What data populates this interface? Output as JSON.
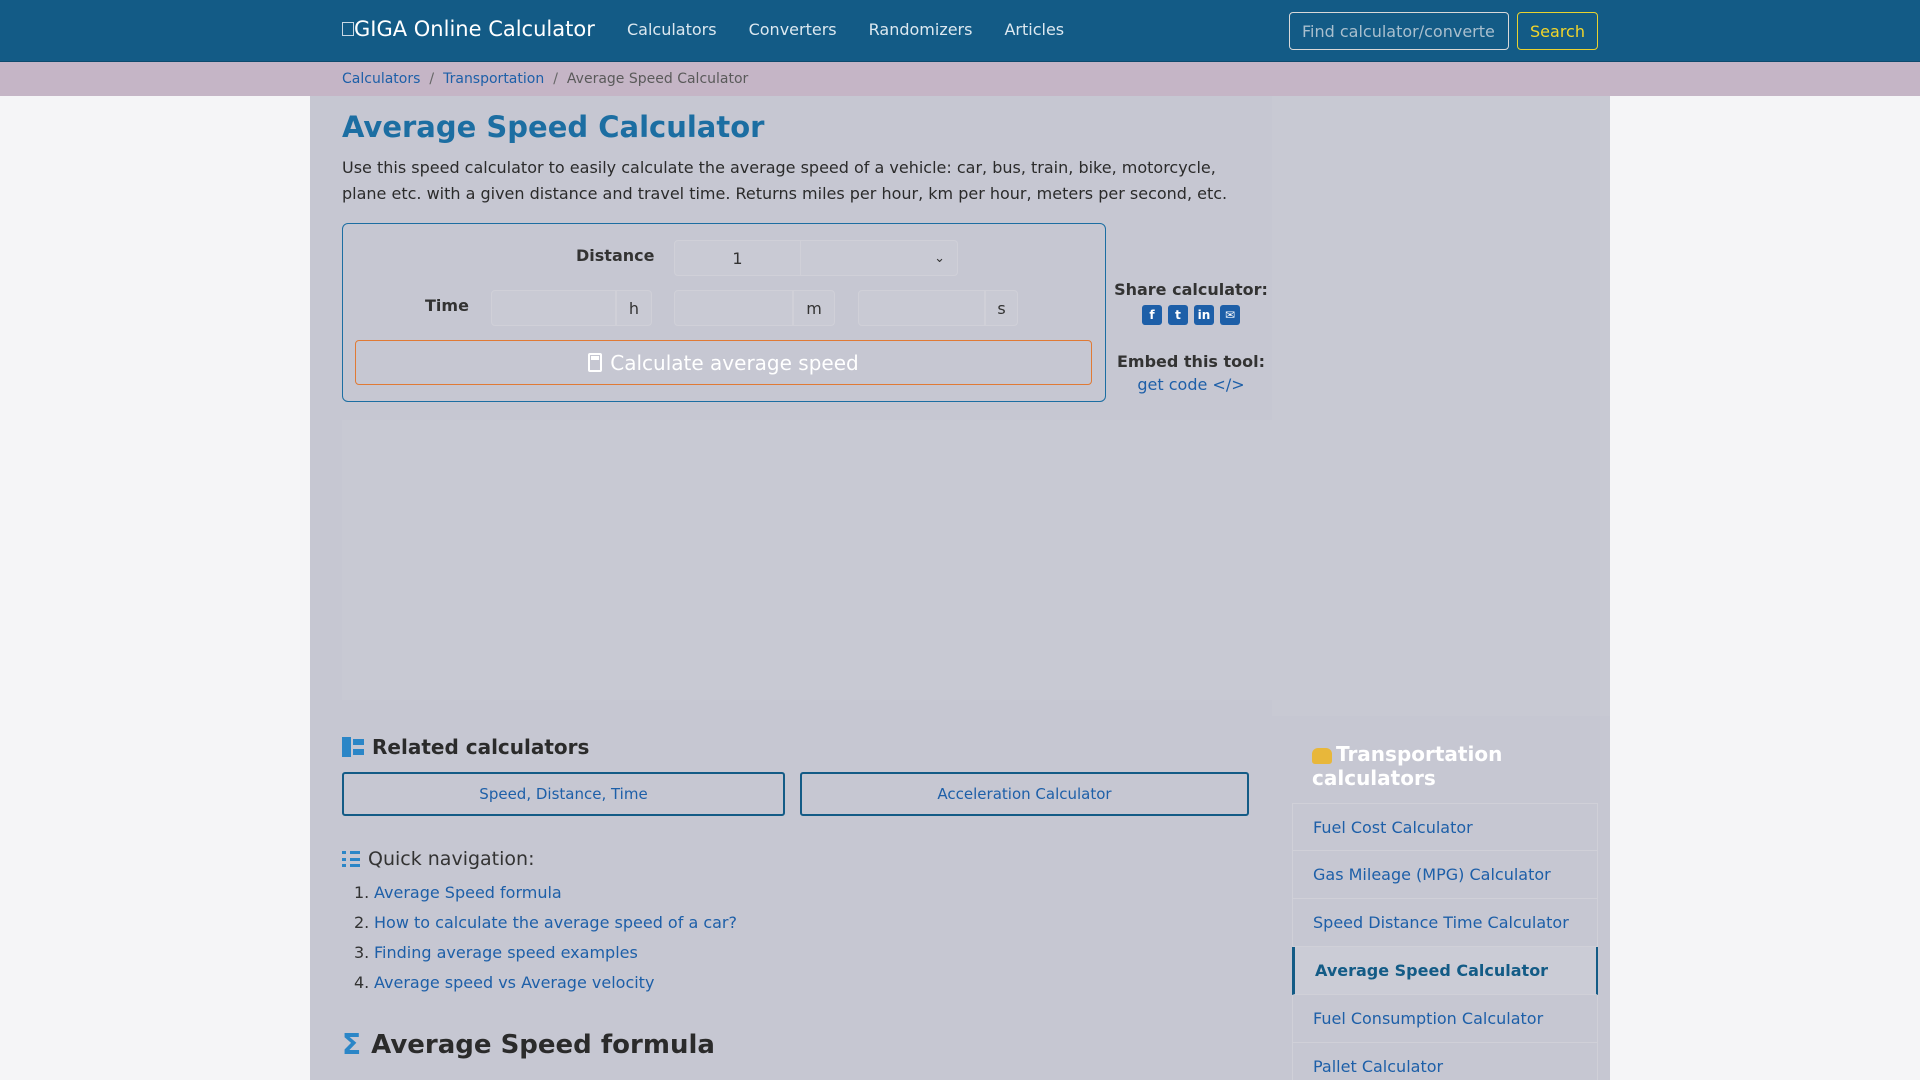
{
  "header": {
    "brand": "GIGA Online Calculator",
    "nav": [
      "Calculators",
      "Converters",
      "Randomizers",
      "Articles"
    ],
    "search_placeholder": "Find calculator/converter",
    "search_button": "Search"
  },
  "breadcrumb": {
    "items": [
      "Calculators",
      "Transportation"
    ],
    "current": "Average Speed Calculator"
  },
  "page": {
    "title": "Average Speed Calculator",
    "intro": "Use this speed calculator to easily calculate the average speed of a vehicle: car, bus, train, bike, motorcycle, plane etc. with a given distance and travel time. Returns miles per hour, km per hour, meters per second, etc."
  },
  "calculator": {
    "distance_label": "Distance",
    "distance_value": "1",
    "time_label": "Time",
    "hours_unit": "h",
    "minutes_unit": "m",
    "seconds_unit": "s",
    "button_label": "Calculate average speed"
  },
  "share": {
    "label": "Share calculator:",
    "icons": [
      "facebook-icon",
      "twitter-icon",
      "linkedin-icon",
      "email-icon"
    ],
    "embed_label": "Embed this tool:",
    "embed_link": "get code </>"
  },
  "related": {
    "title": "Related calculators",
    "items": [
      "Speed, Distance, Time",
      "Acceleration Calculator"
    ]
  },
  "quick_nav": {
    "title": "Quick navigation:",
    "items": [
      "Average Speed formula",
      "How to calculate the average speed of a car?",
      "Finding average speed examples",
      "Average speed vs Average velocity"
    ]
  },
  "formula": {
    "title": "Average Speed formula"
  },
  "sidebar": {
    "title": "Transportation calculators",
    "items": [
      "Fuel Cost Calculator",
      "Gas Mileage (MPG) Calculator",
      "Speed Distance Time Calculator",
      "Average Speed Calculator",
      "Fuel Consumption Calculator",
      "Pallet Calculator"
    ],
    "active_index": 3
  },
  "colors": {
    "nav_bg": "#135b86",
    "accent_blue": "#1c6ea2",
    "search_yellow": "#f2d52a",
    "button_orange": "#e07a35"
  }
}
